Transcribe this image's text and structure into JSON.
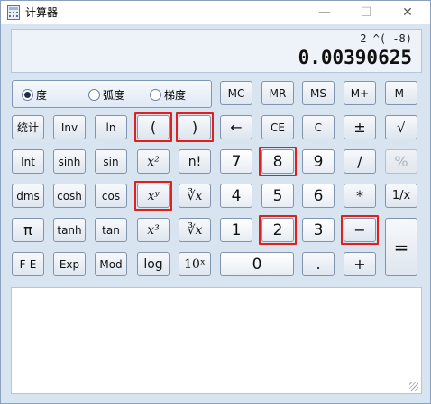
{
  "window": {
    "title": "计算器",
    "minimize": "—",
    "maximize": "☐",
    "close": "✕"
  },
  "display": {
    "expression": "2 ^( -8)",
    "result": "0.00390625"
  },
  "angle_modes": [
    {
      "label": "度",
      "selected": true
    },
    {
      "label": "弧度",
      "selected": false
    },
    {
      "label": "梯度",
      "selected": false
    }
  ],
  "memory": {
    "mc": "MC",
    "mr": "MR",
    "ms": "MS",
    "mplus": "M+",
    "mminus": "M-"
  },
  "row1": {
    "stats": "统计",
    "inv": "Inv",
    "ln": "ln",
    "lparen": "(",
    "rparen": ")",
    "back": "←",
    "ce": "CE",
    "c": "C",
    "plusminus": "±",
    "sqrt": "√"
  },
  "row2": {
    "int": "Int",
    "sinh": "sinh",
    "sin": "sin",
    "x2": "x²",
    "nfact": "n!",
    "d7": "7",
    "d8": "8",
    "d9": "9",
    "div": "/",
    "pct": "%"
  },
  "row3": {
    "dms": "dms",
    "cosh": "cosh",
    "cos": "cos",
    "xy": "xʸ",
    "yroot": "∛x",
    "d4": "4",
    "d5": "5",
    "d6": "6",
    "mul": "*",
    "recip": "1/x"
  },
  "row4": {
    "pi": "π",
    "tanh": "tanh",
    "tan": "tan",
    "x3": "x³",
    "cbrt": "∛x",
    "d1": "1",
    "d2": "2",
    "d3": "3",
    "sub": "−",
    "eq": "="
  },
  "row5": {
    "fe": "F-E",
    "exp": "Exp",
    "mod": "Mod",
    "log": "log",
    "tenx": "10ˣ",
    "d0": "0",
    "dot": ".",
    "add": "+"
  },
  "colors": {
    "highlight": "#e0201c",
    "background": "#d9e4f1"
  }
}
